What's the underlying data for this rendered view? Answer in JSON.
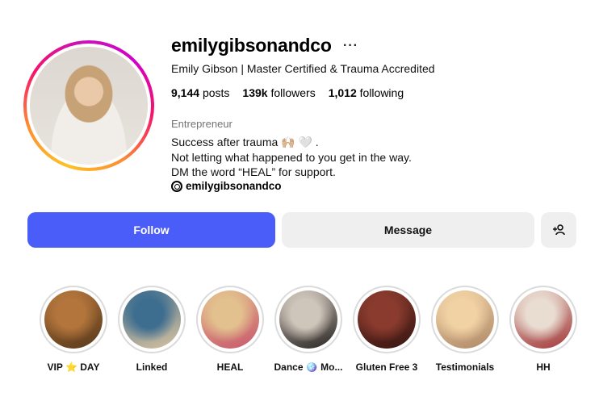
{
  "profile": {
    "username": "emilygibsonandco",
    "more_label": "···",
    "full_name": "Emily Gibson | Master Certified & Trauma Accredited",
    "stats": {
      "posts_count": "9,144",
      "posts_label": "posts",
      "followers_count": "139k",
      "followers_label": "followers",
      "following_count": "1,012",
      "following_label": "following"
    },
    "category": "Entrepreneur",
    "bio_lines": [
      "Success after trauma 🙌🏼 🤍 .",
      "Not letting what happened to you get in the way.",
      "DM the word “HEAL” for support."
    ],
    "threads_handle": "emilygibsonandco"
  },
  "actions": {
    "follow_label": "Follow",
    "message_label": "Message",
    "add_user_icon": "person-plus-icon"
  },
  "highlights": [
    {
      "label": "VIP ⭐ DAY",
      "color_a": "#b3753c",
      "color_b": "#5a3a1c"
    },
    {
      "label": "Linked",
      "color_a": "#3d6d8f",
      "color_b": "#d9c3a0"
    },
    {
      "label": "HEAL",
      "color_a": "#e3c18e",
      "color_b": "#c8576c"
    },
    {
      "label": "Dance 🪩 Mo...",
      "color_a": "#cfc6bb",
      "color_b": "#2a2523"
    },
    {
      "label": "Gluten Free 3",
      "color_a": "#8a3b2e",
      "color_b": "#3a1612"
    },
    {
      "label": "Testimonials",
      "color_a": "#f1d2a4",
      "color_b": "#b08a69"
    },
    {
      "label": "HH",
      "color_a": "#e9dcd1",
      "color_b": "#a33a3a"
    }
  ],
  "colors": {
    "accent": "#4a5df9",
    "secondary_button": "#efefef",
    "muted_text": "#737373"
  }
}
